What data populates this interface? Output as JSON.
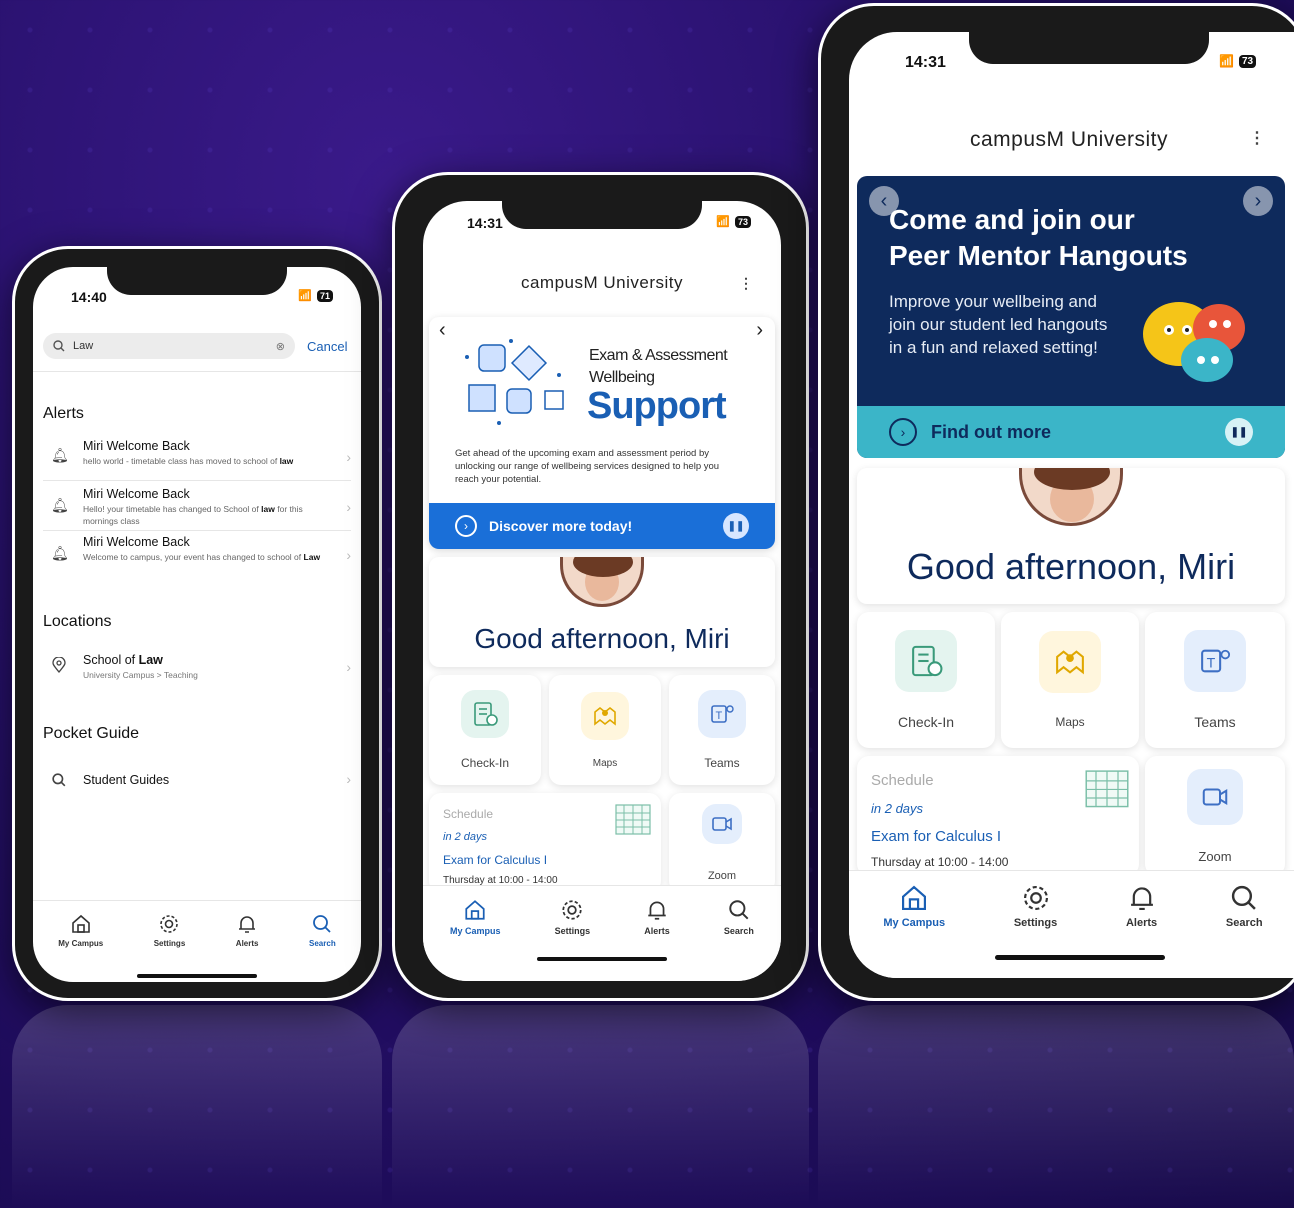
{
  "colors": {
    "brand_blue": "#1a5fb4",
    "navy": "#0e2a5c",
    "teal": "#3bb5c8",
    "bg": "#1e0c5a"
  },
  "phone1": {
    "time": "14:40",
    "battery": "71",
    "search": {
      "value": "Law",
      "cancel": "Cancel"
    },
    "sections": {
      "alerts": "Alerts",
      "locations": "Locations",
      "pocket": "Pocket Guide"
    },
    "alerts": [
      {
        "title": "Miri Welcome Back",
        "body": "hello world - timetable class has moved to school of",
        "bold": "law"
      },
      {
        "title": "Miri Welcome Back",
        "body": "Hello! your timetable has changed to School of",
        "bold": "law",
        "body2": "for this mornings class"
      },
      {
        "title": "Miri Welcome Back",
        "body": "Welcome to campus, your event has changed to",
        "body2": "school of",
        "bold": "Law"
      }
    ],
    "location": {
      "title_pre": "School of ",
      "title_bold": "Law",
      "sub": "University Campus > Teaching"
    },
    "guide": {
      "title": "Student Guides"
    },
    "tabs": [
      "My Campus",
      "Settings",
      "Alerts",
      "Search"
    ]
  },
  "phone2": {
    "time": "14:31",
    "battery": "73",
    "title": "campusM University",
    "banner": {
      "line1": "Exam & Assessment",
      "line2": "Wellbeing",
      "big": "Support",
      "desc": "Get ahead of the upcoming exam and assessment period by unlocking our range of wellbeing services designed to help you reach your potential.",
      "cta": "Discover more today!"
    },
    "greeting": "Good afternoon, Miri",
    "tiles": [
      "Check-In",
      "Maps",
      "Teams"
    ],
    "schedule": {
      "label": "Schedule",
      "when": "in 2 days",
      "event": "Exam for Calculus I",
      "time": "Thursday at 10:00 - 14:00"
    },
    "zoom": "Zoom",
    "tabs": [
      "My Campus",
      "Settings",
      "Alerts",
      "Search"
    ]
  },
  "phone3": {
    "time": "14:31",
    "battery": "73",
    "title": "campusM University",
    "banner": {
      "heading1": "Come and join our",
      "heading2": "Peer Mentor Hangouts",
      "desc": "Improve your wellbeing and join our student led hangouts in a fun and relaxed setting!",
      "cta": "Find out more"
    },
    "greeting": "Good afternoon, Miri",
    "tiles": [
      "Check-In",
      "Maps",
      "Teams"
    ],
    "schedule": {
      "label": "Schedule",
      "when": "in 2 days",
      "event": "Exam for Calculus I",
      "time": "Thursday at 10:00 - 14:00"
    },
    "zoom": "Zoom",
    "tabs": [
      "My Campus",
      "Settings",
      "Alerts",
      "Search"
    ]
  }
}
